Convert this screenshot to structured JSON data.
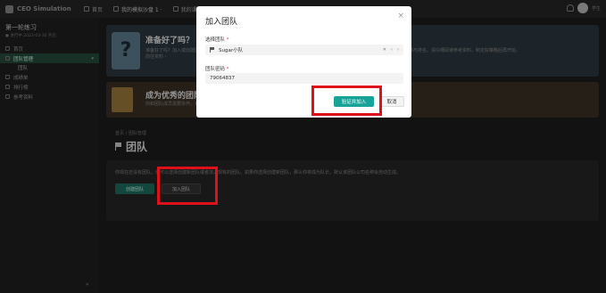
{
  "app": {
    "name": "CEO Simulation"
  },
  "topnav": {
    "items": [
      {
        "label": "首页"
      },
      {
        "label": "我的模拟沙盘 1 ·"
      },
      {
        "label": "我的课程"
      }
    ],
    "user_label": "学生"
  },
  "sidebar": {
    "course_title": "第一轮练习",
    "course_meta": "● 进行中 2023-03-30 开启",
    "items": [
      {
        "label": "首页"
      },
      {
        "label": "团队管理"
      },
      {
        "label": "团队"
      },
      {
        "label": "成绩单"
      },
      {
        "label": "排行榜"
      },
      {
        "label": "参考资料"
      }
    ],
    "collapse": "«"
  },
  "main": {
    "card1": {
      "icon_text": "?",
      "title": "准备好了吗？",
      "body": "准备好了吗？加入或创建团队后，您可以与队友一起参与模拟经营，在每个回合中做出决策。根据您的团队的表现，您将获得相应的成绩与排名。请仔细阅读参考资料，制定好策略后再开始。",
      "link": "前往资料 ›"
    },
    "card2": {
      "title": "成为优秀的团队",
      "body": "你和团队成员需要协作，充分讨论每一项决策。如果你还没有团队，请先创建或加入一个团队，默认的团队名称为公司名称。"
    },
    "breadcrumb": "首页 / 团队管理",
    "page_title": "团队",
    "team_card": {
      "desc": "你现在还没有团队，你可以选择创建新团队或者加入现有的团队。如果你选择创建新团队，那么你将成为队长，默认该团队公司名称会自动生成。",
      "create_button": "创建团队",
      "join_button": "加入团队"
    }
  },
  "modal": {
    "title": "加入团队",
    "close": "×",
    "team_label": "选择团队",
    "required_mark": "*",
    "team_value": "Sugar小队",
    "select_controls": [
      "✕",
      "‹",
      "›"
    ],
    "password_label": "团队密码",
    "password_value": "79064837",
    "confirm_button": "验证并加入",
    "cancel_button": "取消"
  },
  "highlight_color": "#e0101a",
  "accent_color": "#17a398"
}
